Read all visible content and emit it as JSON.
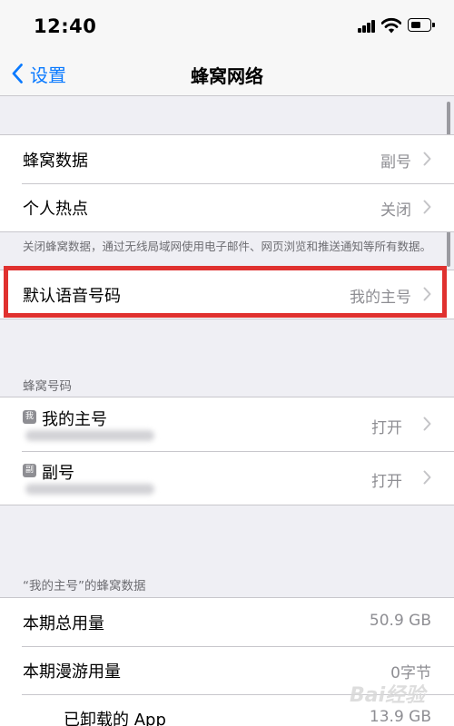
{
  "status_bar": {
    "time": "12:40"
  },
  "nav": {
    "back_label": "设置",
    "title": "蜂窝网络"
  },
  "group1": {
    "items": [
      {
        "label": "蜂窝数据",
        "value": "副号"
      },
      {
        "label": "个人热点",
        "value": "关闭"
      }
    ],
    "footer": "关闭蜂窝数据，通过无线局域网使用电子邮件、网页浏览和推送通知等所有数据。"
  },
  "group2": {
    "items": [
      {
        "label": "默认语音号码",
        "value": "我的主号"
      }
    ]
  },
  "sim_section": {
    "header": "蜂窝号码",
    "items": [
      {
        "badge": "我",
        "name": "我的主号",
        "value": "打开"
      },
      {
        "badge": "副",
        "name": "副号",
        "value": "打开"
      }
    ]
  },
  "usage_section": {
    "header": "“我的主号”的蜂窝数据",
    "items": [
      {
        "label": "本期总用量",
        "value": "50.9 GB"
      },
      {
        "label": "本期漫游用量",
        "value": "0字节"
      },
      {
        "label": "已卸载的 App",
        "value": "13.9 GB"
      }
    ]
  },
  "watermark": "Bai经验",
  "colors": {
    "accent": "#0a7aff",
    "highlight": "#e0312f",
    "secondary_text": "#8e8e93"
  }
}
